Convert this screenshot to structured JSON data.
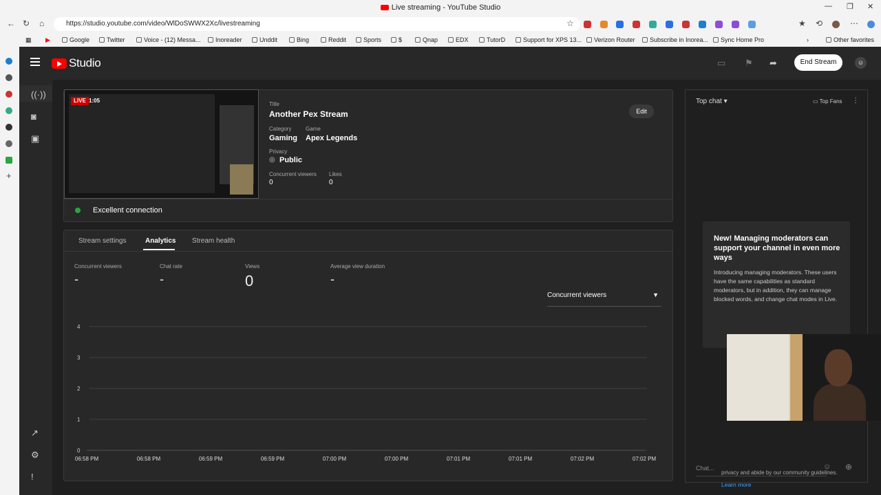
{
  "browser": {
    "window_title": "Live streaming - YouTube Studio",
    "url": "https://studio.youtube.com/video/WlDoSWWX2Xc/livestreaming",
    "bookmarks": [
      "Google",
      "Twitter",
      "Voice - (12) Messa...",
      "Inoreader",
      "Unddit",
      "Bing",
      "Reddit",
      "Sports",
      "$",
      "Qnap",
      "EDX",
      "TutorD",
      "Support for XPS 13...",
      "Verizon Router",
      "Subscribe in Inorea...",
      "Sync Home Pro"
    ],
    "other_favorites": "Other favorites"
  },
  "studio": {
    "logo_text": "Studio",
    "end_stream_label": "End Stream"
  },
  "stream": {
    "live_badge": "LIVE",
    "live_time": "1:05",
    "title_label": "Title",
    "title": "Another Pex Stream",
    "category_label": "Category",
    "category": "Gaming",
    "game_label": "Game",
    "game": "Apex Legends",
    "privacy_label": "Privacy",
    "privacy": "Public",
    "concurrent_label": "Concurrent viewers",
    "concurrent": "0",
    "likes_label": "Likes",
    "likes": "0",
    "edit_label": "Edit",
    "connection": "Excellent connection"
  },
  "tabs": [
    "Stream settings",
    "Analytics",
    "Stream health"
  ],
  "metrics": [
    {
      "label": "Concurrent viewers",
      "value": "-"
    },
    {
      "label": "Chat rate",
      "value": "-"
    },
    {
      "label": "Views",
      "value": "0"
    },
    {
      "label": "Average view duration",
      "value": "-"
    }
  ],
  "chart_select": "Concurrent viewers",
  "chart_data": {
    "type": "line",
    "title": "",
    "xlabel": "",
    "ylabel": "",
    "ylim": [
      0,
      4
    ],
    "yticks": [
      "0",
      "1",
      "2",
      "3",
      "4"
    ],
    "x": [
      "06:58 PM",
      "06:58 PM",
      "06:59 PM",
      "06:59 PM",
      "07:00 PM",
      "07:00 PM",
      "07:01 PM",
      "07:01 PM",
      "07:02 PM",
      "07:02 PM"
    ],
    "series": [
      {
        "values": [
          0,
          0,
          0,
          0,
          0,
          0,
          0,
          0,
          0,
          0
        ]
      }
    ],
    "grid": true
  },
  "chat": {
    "header": "Top chat",
    "top_fans": "Top Fans",
    "promo_title": "New! Managing moderators can support your channel in even more ways",
    "promo_body": "Introducing managing moderators. These users have the same capabilities as standard moderators, but in addition, they can manage blocked words, and change chat modes in Live.",
    "guideline": "privacy and abide by our community guidelines.",
    "learn_more": "Learn more",
    "placeholder": "Chat..."
  }
}
